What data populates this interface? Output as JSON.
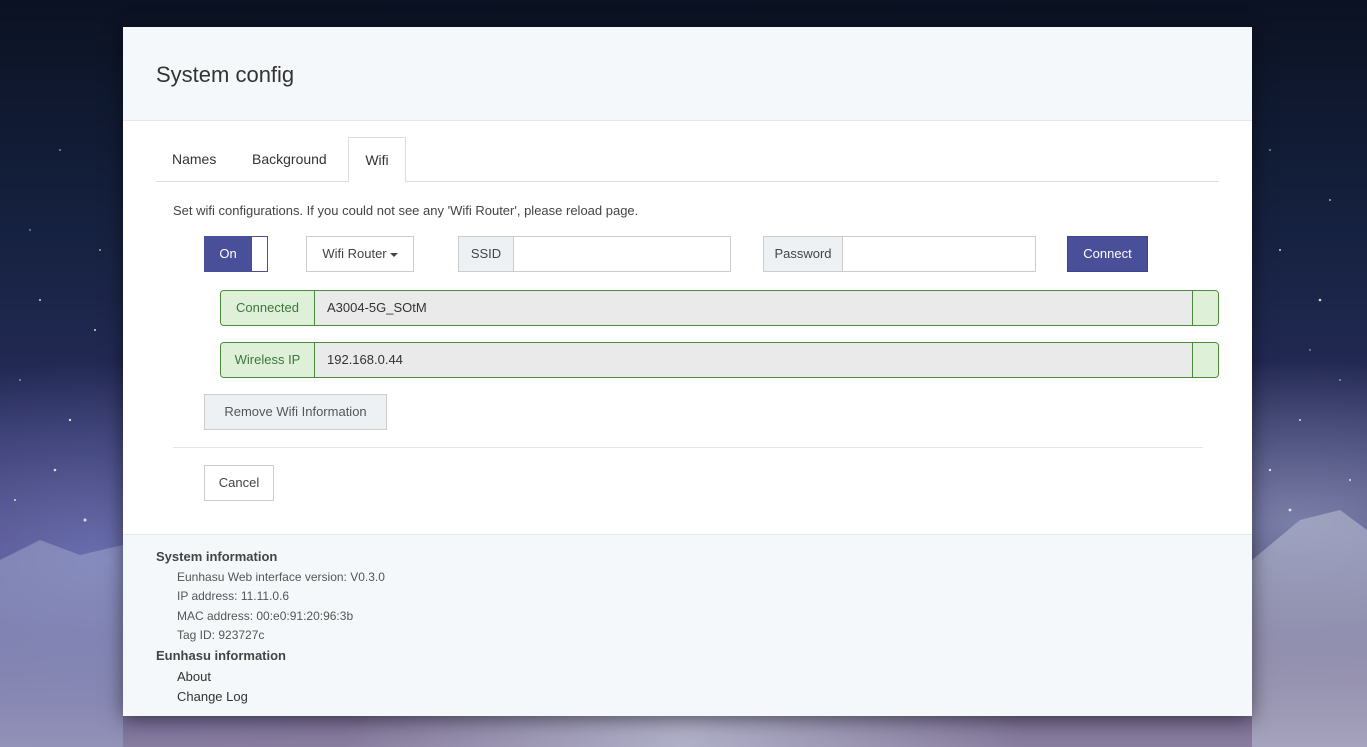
{
  "modal": {
    "title": "System config"
  },
  "tabs": [
    {
      "label": "Names",
      "active": false
    },
    {
      "label": "Background",
      "active": false
    },
    {
      "label": "Wifi",
      "active": true
    }
  ],
  "wifi": {
    "description": "Set wifi configurations. If you could not see any 'Wifi Router', please reload page.",
    "toggle_label": "On",
    "router_dropdown_label": "Wifi Router",
    "ssid_label": "SSID",
    "ssid_value": "",
    "password_label": "Password",
    "password_value": "",
    "connect_label": "Connect",
    "status_label": "Connected",
    "status_value": "A3004-5G_SOtM",
    "ip_label": "Wireless IP",
    "ip_value": "192.168.0.44",
    "remove_label": "Remove Wifi Information"
  },
  "cancel_label": "Cancel",
  "footer": {
    "system_title": "System information",
    "version": "Eunhasu Web interface version: V0.3.0",
    "ip": "IP address: 11.11.0.6",
    "mac": "MAC address: 00:e0:91:20:96:3b",
    "tag": "Tag ID: 923727c",
    "eunhasu_title": "Eunhasu information",
    "about": "About",
    "changelog": "Change Log"
  },
  "colors": {
    "accent": "#4a4f9a",
    "success_border": "#4a8a3a",
    "success_bg": "#dff0d8"
  }
}
